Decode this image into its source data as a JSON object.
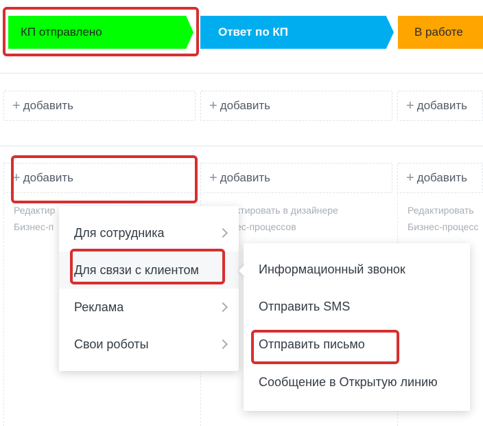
{
  "stages": [
    {
      "label": "КП отправлено",
      "color": "#00ff00"
    },
    {
      "label": "Ответ по КП",
      "color": "#00aeef"
    },
    {
      "label": "В работе",
      "color": "#ffa500"
    }
  ],
  "row1": {
    "add_label": "добавить"
  },
  "row2": {
    "add_label": "добавить",
    "hint_col2_line1": "ктировать в дизайнере",
    "hint_col2_line2": "ес-процессов",
    "hint_col3_line1": "Редактировать",
    "hint_col3_line2": "Бизнес-процесс",
    "hint_col1_line1": "Редактир",
    "hint_col1_line2": "Бизнес-п"
  },
  "menu_main": {
    "items": [
      {
        "label": "Для сотрудника"
      },
      {
        "label": "Для связи с клиентом"
      },
      {
        "label": "Реклама"
      },
      {
        "label": "Свои роботы"
      }
    ]
  },
  "menu_sub": {
    "items": [
      {
        "label": "Информационный звонок"
      },
      {
        "label": "Отправить SMS"
      },
      {
        "label": "Отправить письмо"
      },
      {
        "label": "Сообщение в Открытую линию"
      }
    ]
  },
  "colors": {
    "highlight": "#d72f2f"
  }
}
